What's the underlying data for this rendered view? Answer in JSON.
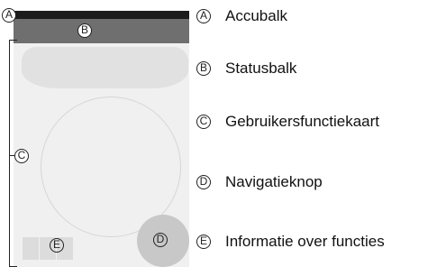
{
  "markers": {
    "battery": "A",
    "status": "B",
    "user_card": "C",
    "nav": "D",
    "info": "E"
  },
  "legend": [
    {
      "marker": "A",
      "label": "Accubalk"
    },
    {
      "marker": "B",
      "label": "Statusbalk"
    },
    {
      "marker": "C",
      "label": "Gebruikersfunctiekaart"
    },
    {
      "marker": "D",
      "label": "Navigatieknop"
    },
    {
      "marker": "E",
      "label": "Informatie over functies"
    }
  ],
  "colors": {
    "battery_bar": "#1c1c1c",
    "status_bar": "#6f6f6f",
    "screen": "#f0f0f0",
    "nav_button": "#c8c8c8"
  }
}
